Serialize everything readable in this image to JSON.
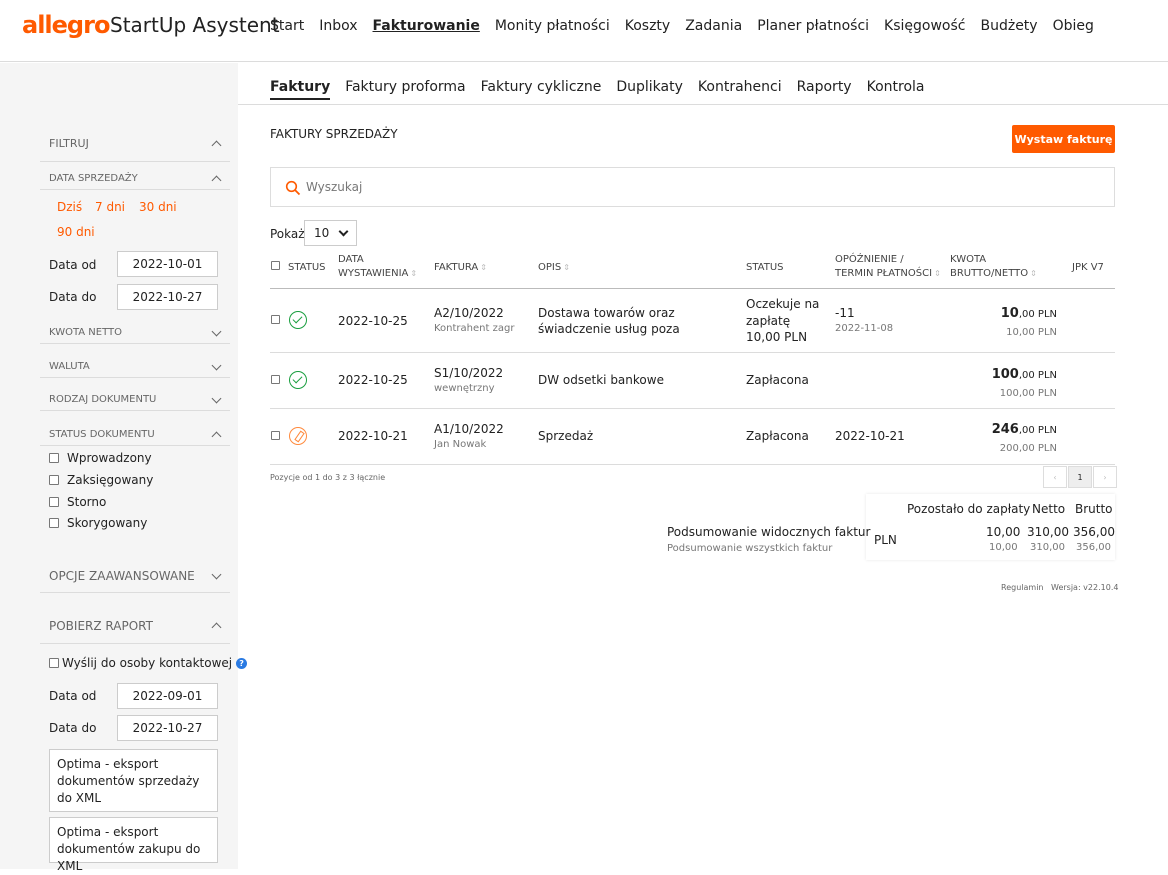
{
  "app": {
    "logo": "allegro",
    "name": "StartUp Asystent"
  },
  "mainnav": [
    "Start",
    "Inbox",
    "Fakturowanie",
    "Monity płatności",
    "Koszty",
    "Zadania",
    "Planer płatności",
    "Księgowość",
    "Budżety",
    "Obieg"
  ],
  "subnav": [
    "Faktury",
    "Faktury proforma",
    "Faktury cykliczne",
    "Duplikaty",
    "Kontrahenci",
    "Raporty",
    "Kontrola"
  ],
  "sidebar": {
    "filter_title": "FILTRUJ",
    "sale_date_title": "DATA SPRZEDAŻY",
    "quick": [
      "Dziś",
      "7 dni",
      "30 dni",
      "90 dni"
    ],
    "date_from_label": "Data od",
    "date_from": "2022-10-01",
    "date_to_label": "Data do",
    "date_to": "2022-10-27",
    "net_amount": "KWOTA NETTO",
    "currency": "WALUTA",
    "doc_type": "RODZAJ DOKUMENTU",
    "doc_status": "STATUS DOKUMENTU",
    "statuses": [
      "Wprowadzony",
      "Zaksięgowany",
      "Storno",
      "Skorygowany"
    ],
    "advanced": "OPCJE ZAAWANSOWANE",
    "report": "POBIERZ RAPORT",
    "send_contact": "Wyślij do osoby kontaktowej",
    "rep_from_label": "Data od",
    "rep_from": "2022-09-01",
    "rep_to_label": "Data do",
    "rep_to": "2022-10-27",
    "export1": "Optima - eksport dokumentów sprzedaży do XML",
    "export2": "Optima - eksport dokumentów zakupu do XML"
  },
  "main": {
    "title": "FAKTURY SPRZEDAŻY",
    "issue_button": "Wystaw fakturę",
    "search_placeholder": "Wyszukaj",
    "show_label": "Pokaż",
    "show_value": "10",
    "headers": {
      "status": "STATUS",
      "date1": "DATA",
      "date2": "WYSTAWIENIA",
      "invoice": "FAKTURA",
      "desc": "OPIS",
      "status2": "STATUS",
      "delay1": "OPÓŹNIENIE /",
      "delay2": "TERMIN PŁATNOŚCI",
      "amount1": "KWOTA",
      "amount2": "BRUTTO/NETTO",
      "jpk": "JPK V7"
    },
    "rows": [
      {
        "status_icon": "check-circle-icon",
        "date": "2022-10-25",
        "invoice": "A2/10/2022",
        "invoice_sub": "Kontrahent zagr",
        "desc1": "Dostawa towarów oraz",
        "desc2": "świadczenie usług poza",
        "status1": "Oczekuje na",
        "status2": "zapłatę",
        "status3": "10,00 PLN",
        "delay": "-11",
        "delay_sub": "2022-11-08",
        "gross_int": "10",
        "gross_dec": ",00 PLN",
        "net": "10,00 PLN"
      },
      {
        "status_icon": "check-circle-icon",
        "date": "2022-10-25",
        "invoice": "S1/10/2022",
        "invoice_sub": "wewnętrzny",
        "desc1": "DW odsetki bankowe",
        "status1": "Zapłacona",
        "gross_int": "100",
        "gross_dec": ",00 PLN",
        "net": "100,00 PLN"
      },
      {
        "status_icon": "edit-circle-icon",
        "date": "2022-10-21",
        "invoice": "A1/10/2022",
        "invoice_sub": "Jan Nowak",
        "desc1": "Sprzedaż",
        "status1": "Zapłacona",
        "delay": "2022-10-21",
        "gross_int": "246",
        "gross_dec": ",00 PLN",
        "net": "200,00 PLN"
      }
    ],
    "pagination_info": "Pozycje od 1 do 3 z 3 łącznie",
    "page": "1",
    "summary": {
      "h_remaining": "Pozostało do zapłaty",
      "h_net": "Netto",
      "h_gross": "Brutto",
      "visible_label": "Podsumowanie widocznych faktur",
      "all_label": "Podsumowanie wszystkich faktur",
      "currency": "PLN",
      "remaining": "10,00",
      "net": "310,00",
      "gross": "356,00",
      "remaining_all": "10,00",
      "net_all": "310,00",
      "gross_all": "356,00"
    },
    "footer_terms": "Regulamin",
    "footer_version": "Wersja: v22.10.4"
  },
  "colors": {
    "accent": "#ff5a00",
    "ok": "#1a9e3f"
  }
}
